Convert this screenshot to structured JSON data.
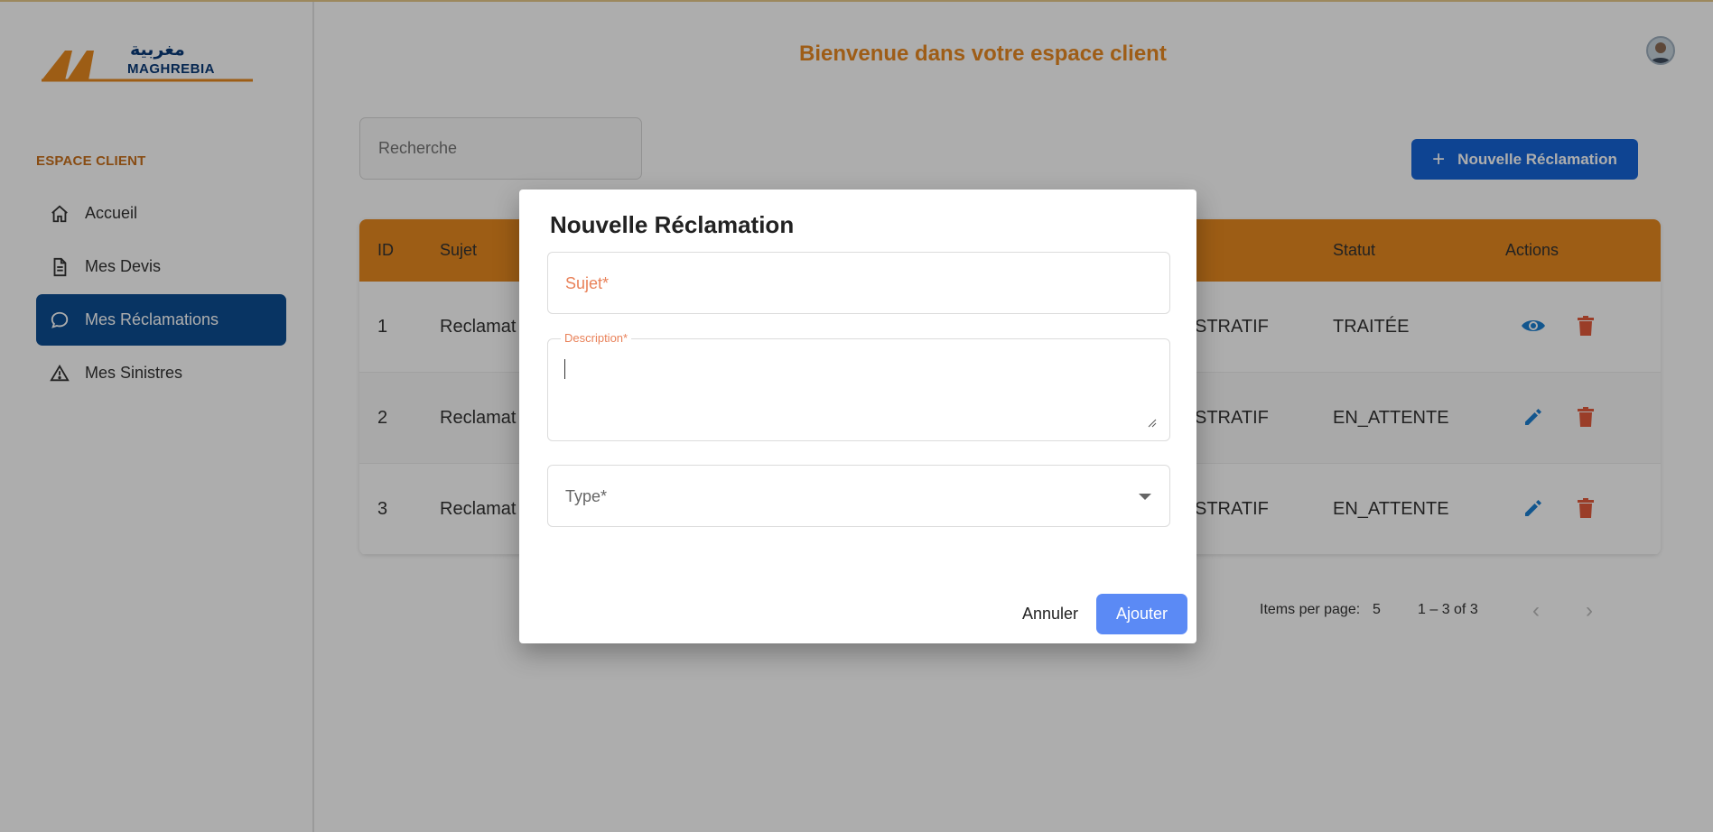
{
  "header": {
    "welcome": "Bienvenue dans votre espace client"
  },
  "logo": {
    "name": "MAGHREBIA",
    "arabic": "مغربية"
  },
  "sidebar": {
    "section": "ESPACE CLIENT",
    "items": [
      {
        "label": "Accueil",
        "icon": "home-icon",
        "active": false
      },
      {
        "label": "Mes Devis",
        "icon": "document-icon",
        "active": false
      },
      {
        "label": "Mes Réclamations",
        "icon": "chat-bubble-icon",
        "active": true
      },
      {
        "label": "Mes Sinistres",
        "icon": "warning-icon",
        "active": false
      }
    ]
  },
  "search": {
    "placeholder": "Recherche"
  },
  "new_button": {
    "label": "Nouvelle Réclamation",
    "plus": "+"
  },
  "table": {
    "columns": {
      "id": "ID",
      "subject": "Sujet",
      "status": "Statut",
      "actions": "Actions"
    },
    "rows": [
      {
        "id": "1",
        "subject": "Reclamat",
        "type": "STRATIF",
        "status": "TRAITÉE",
        "primary_action": "view-icon"
      },
      {
        "id": "2",
        "subject": "Reclamat",
        "type": "STRATIF",
        "status": "EN_ATTENTE",
        "primary_action": "edit-icon"
      },
      {
        "id": "3",
        "subject": "Reclamat",
        "type": "STRATIF",
        "status": "EN_ATTENTE",
        "primary_action": "edit-icon"
      }
    ]
  },
  "pagination": {
    "items_per_page_label": "Items per page:",
    "items_per_page": "5",
    "range": "1 – 3 of 3",
    "prev": "‹",
    "next": "›"
  },
  "dialog": {
    "title": "Nouvelle Réclamation",
    "subject_label": "Sujet*",
    "description_label": "Description*",
    "type_label": "Type*",
    "cancel": "Annuler",
    "add": "Ajouter"
  },
  "colors": {
    "accent_orange": "#e8891f",
    "primary_blue": "#1565d8",
    "nav_active": "#0d4d92",
    "delete_red": "#e35b3b",
    "view_blue": "#1b7fd1"
  }
}
